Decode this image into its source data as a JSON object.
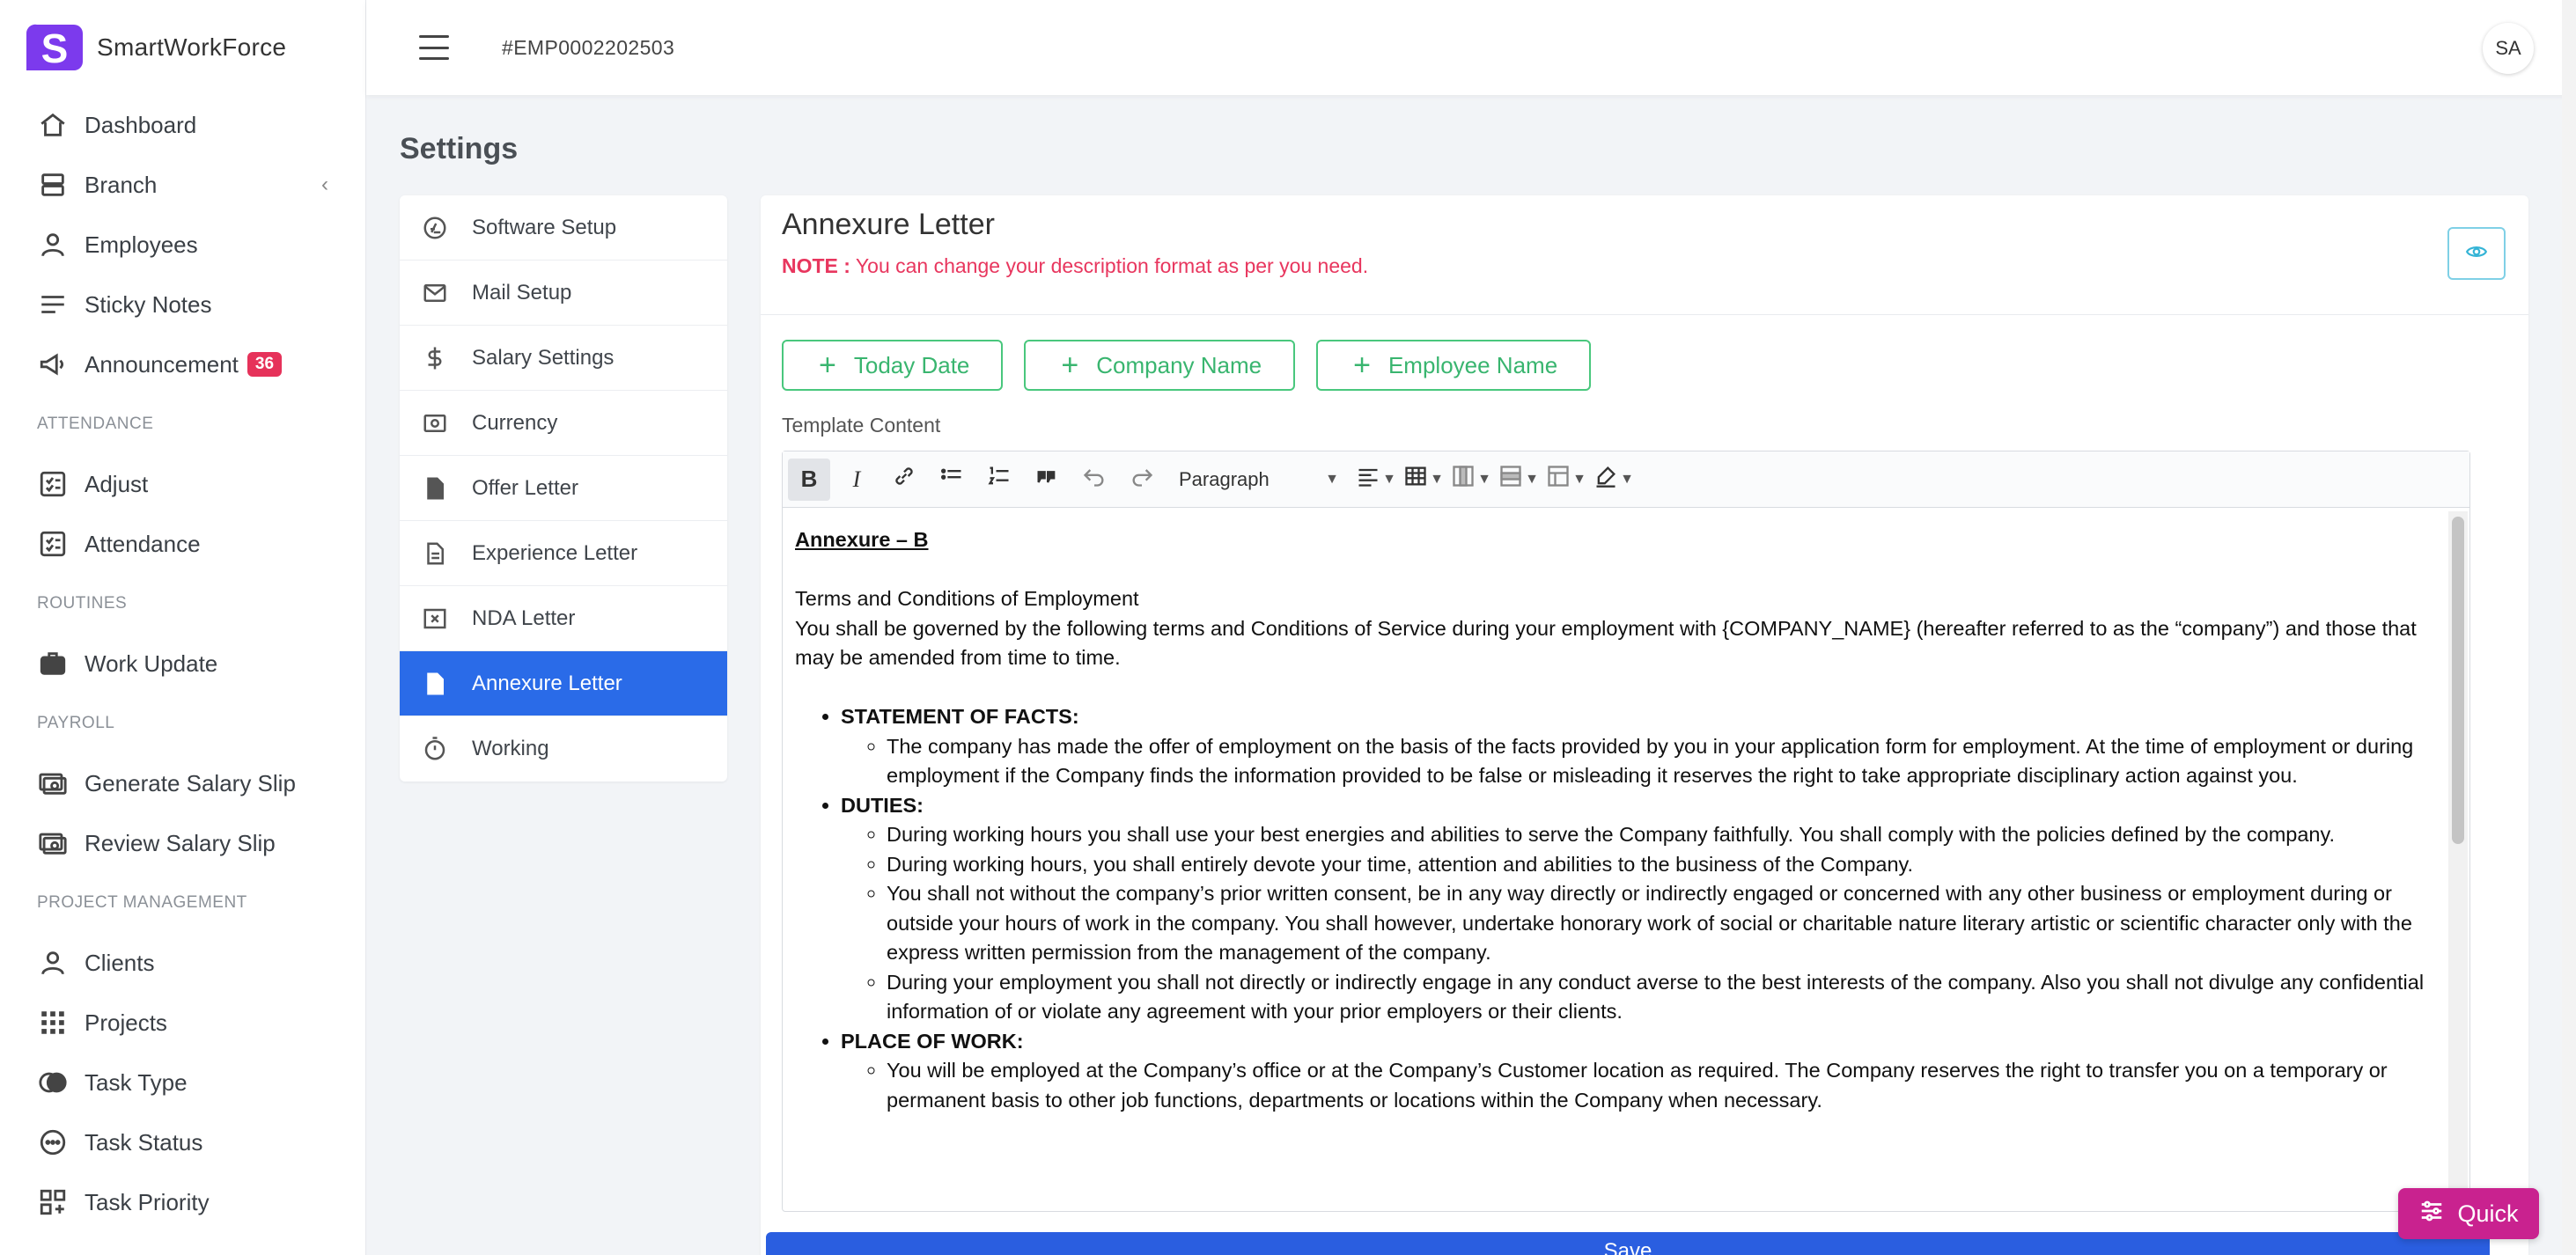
{
  "app": {
    "name": "SmartWorkForce",
    "logo_letter": "S",
    "brand_color": "#7c3aed"
  },
  "header": {
    "employee_id": "#EMP0002202503",
    "avatar_initials": "SA"
  },
  "sidebar": {
    "items": [
      {
        "label": "Dashboard",
        "icon": "home-icon"
      },
      {
        "label": "Branch",
        "icon": "server-icon",
        "chevron": "‹"
      },
      {
        "label": "Employees",
        "icon": "user-icon"
      },
      {
        "label": "Sticky Notes",
        "icon": "lines-icon"
      },
      {
        "label": "Announcement",
        "icon": "megaphone-icon",
        "badge": "36"
      }
    ],
    "sections": [
      {
        "title": "ATTENDANCE",
        "items": [
          {
            "label": "Adjust"
          },
          {
            "label": "Attendance"
          }
        ]
      },
      {
        "title": "ROUTINES",
        "items": [
          {
            "label": "Work Update"
          }
        ]
      },
      {
        "title": "PAYROLL",
        "items": [
          {
            "label": "Generate Salary Slip"
          },
          {
            "label": "Review Salary Slip"
          }
        ]
      },
      {
        "title": "PROJECT MANAGEMENT",
        "items": [
          {
            "label": "Clients"
          },
          {
            "label": "Projects"
          },
          {
            "label": "Task Type"
          },
          {
            "label": "Task Status"
          },
          {
            "label": "Task Priority"
          }
        ]
      }
    ]
  },
  "page": {
    "title": "Settings"
  },
  "settings_menu": [
    {
      "label": "Software Setup"
    },
    {
      "label": "Mail Setup"
    },
    {
      "label": "Salary Settings"
    },
    {
      "label": "Currency"
    },
    {
      "label": "Offer Letter"
    },
    {
      "label": "Experience Letter"
    },
    {
      "label": "NDA Letter"
    },
    {
      "label": "Annexure Letter",
      "active": true
    },
    {
      "label": "Working"
    }
  ],
  "card": {
    "title": "Annexure Letter",
    "note_prefix": "NOTE :",
    "note_text": " You can change your description format as per you need.",
    "buttons": {
      "today_date": "Today Date",
      "company_name": "Company Name",
      "employee_name": "Employee Name"
    },
    "template_label": "Template Content"
  },
  "editor": {
    "paragraph_select": "Paragraph",
    "content": {
      "heading": "Annexure – B",
      "intro_title": "Terms and Conditions of Employment",
      "intro_text": "You shall be governed by the following terms and Conditions of Service during your employment with {COMPANY_NAME} (hereafter referred to as the “company”) and those that may be amended from time to time.",
      "sections": [
        {
          "title": "STATEMENT OF FACTS:",
          "points": [
            "The company has made the offer of employment on the basis of the facts provided by you in your application form for employment. At the time of employment or during employment if the Company finds the information provided to be false or misleading it reserves the right to take appropriate disciplinary action against you."
          ]
        },
        {
          "title": "DUTIES:",
          "points": [
            "During working hours you shall use your best energies and abilities to serve the Company faithfully. You shall comply with the policies defined by the company.",
            "During working hours, you shall entirely devote your time, attention and abilities to the business of the Company.",
            "You shall not without the company’s prior written consent, be in any way directly or indirectly engaged or concerned with any other business or employment during or outside your hours of work in the company. You shall however, undertake honorary work of social or charitable nature literary artistic or scientific character only with the express written permission from the management of the company.",
            "During your employment you shall not directly or indirectly engage in any conduct averse to the best interests of the company. Also you shall not divulge any confidential information of or violate any agreement with your prior employers or their clients."
          ]
        },
        {
          "title": "PLACE OF WORK:",
          "points": [
            "You will be employed at the Company’s office or at the Company’s Customer location as required. The Company reserves the right to transfer you on a temporary or permanent basis to other job functions, departments or locations within the Company when necessary."
          ]
        }
      ]
    }
  },
  "save_button": "Save",
  "quick_button": "Quick",
  "colors": {
    "accent": "#2a6be8",
    "note": "#e8365e",
    "success": "#39b56f",
    "quick": "#c9228f",
    "badge": "#e6325a"
  }
}
